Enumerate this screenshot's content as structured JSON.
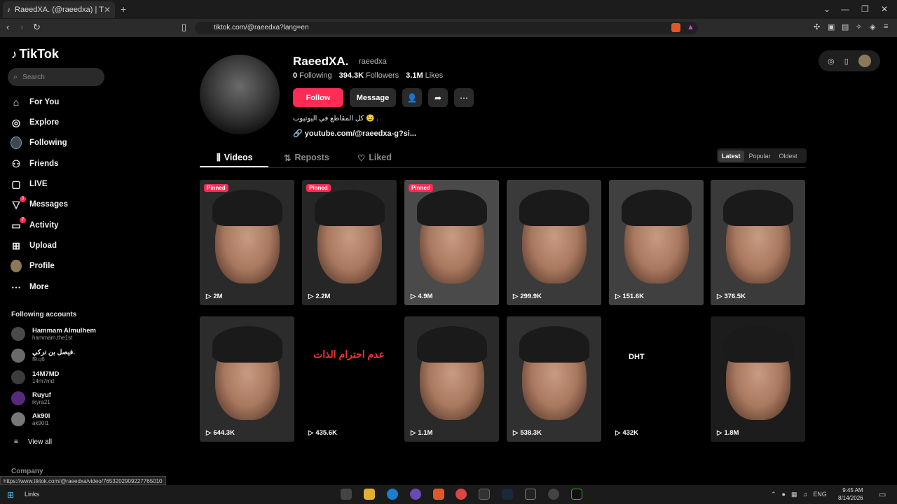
{
  "browser": {
    "tab_title": "RaeedXA. (@raeedxa) | TikTok",
    "url": "tiktok.com/@raeedxa?lang=en",
    "status_url": "https://www.tiktok.com/@raeedxa/video/7653202909227765010"
  },
  "sidebar": {
    "logo": "TikTok",
    "search_placeholder": "Search",
    "items": [
      {
        "label": "For You",
        "icon": "home-icon"
      },
      {
        "label": "Explore",
        "icon": "compass-icon"
      },
      {
        "label": "Following",
        "icon": "following-avatar-icon"
      },
      {
        "label": "Friends",
        "icon": "friends-icon"
      },
      {
        "label": "LIVE",
        "icon": "live-icon"
      },
      {
        "label": "Messages",
        "icon": "messages-icon",
        "badge": "3"
      },
      {
        "label": "Activity",
        "icon": "activity-icon",
        "badge": "7"
      },
      {
        "label": "Upload",
        "icon": "upload-icon"
      },
      {
        "label": "Profile",
        "icon": "profile-avatar-icon"
      },
      {
        "label": "More",
        "icon": "more-icon"
      }
    ],
    "following_title": "Following accounts",
    "accounts": [
      {
        "name": "Hammam Almulhem",
        "handle": "hammam.the1st"
      },
      {
        "name": "فيصل بن تركي.",
        "handle": "f9.q6"
      },
      {
        "name": "14M7MD",
        "handle": "14m7md"
      },
      {
        "name": "Ruyuf",
        "handle": "ikyra21"
      },
      {
        "name": "Ak90l",
        "handle": "ak90l1"
      }
    ],
    "view_all": "View all",
    "company": "Company"
  },
  "profile": {
    "name": "RaeedXA.",
    "handle": "raeedxa",
    "following_count": "0",
    "following_label": "Following",
    "followers_count": "394.3K",
    "followers_label": "Followers",
    "likes_count": "3.1M",
    "likes_label": "Likes",
    "follow_label": "Follow",
    "message_label": "Message",
    "bio": "كل المقاطع في اليوتيوب 😉 .",
    "link": "youtube.com/@raeedxa-g?si..."
  },
  "tabs": {
    "videos": "Videos",
    "reposts": "Reposts",
    "liked": "Liked"
  },
  "sort": {
    "latest": "Latest",
    "popular": "Popular",
    "oldest": "Oldest"
  },
  "videos": [
    {
      "views": "2M",
      "pinned": "Pinned"
    },
    {
      "views": "2.2M",
      "pinned": "Pinned"
    },
    {
      "views": "4.9M",
      "pinned": "Pinned"
    },
    {
      "views": "299.9K"
    },
    {
      "views": "151.6K"
    },
    {
      "views": "376.5K"
    },
    {
      "views": "644.3K"
    },
    {
      "views": "435.6K",
      "overlay": "عدم احترام الذات"
    },
    {
      "views": "1.1M"
    },
    {
      "views": "538.3K"
    },
    {
      "views": "432K",
      "overlay": "DHT"
    },
    {
      "views": "1.8M"
    }
  ],
  "taskbar": {
    "links": "Links",
    "lang": "ENG",
    "time": "9:45 AM",
    "date": "8/14/2026"
  }
}
